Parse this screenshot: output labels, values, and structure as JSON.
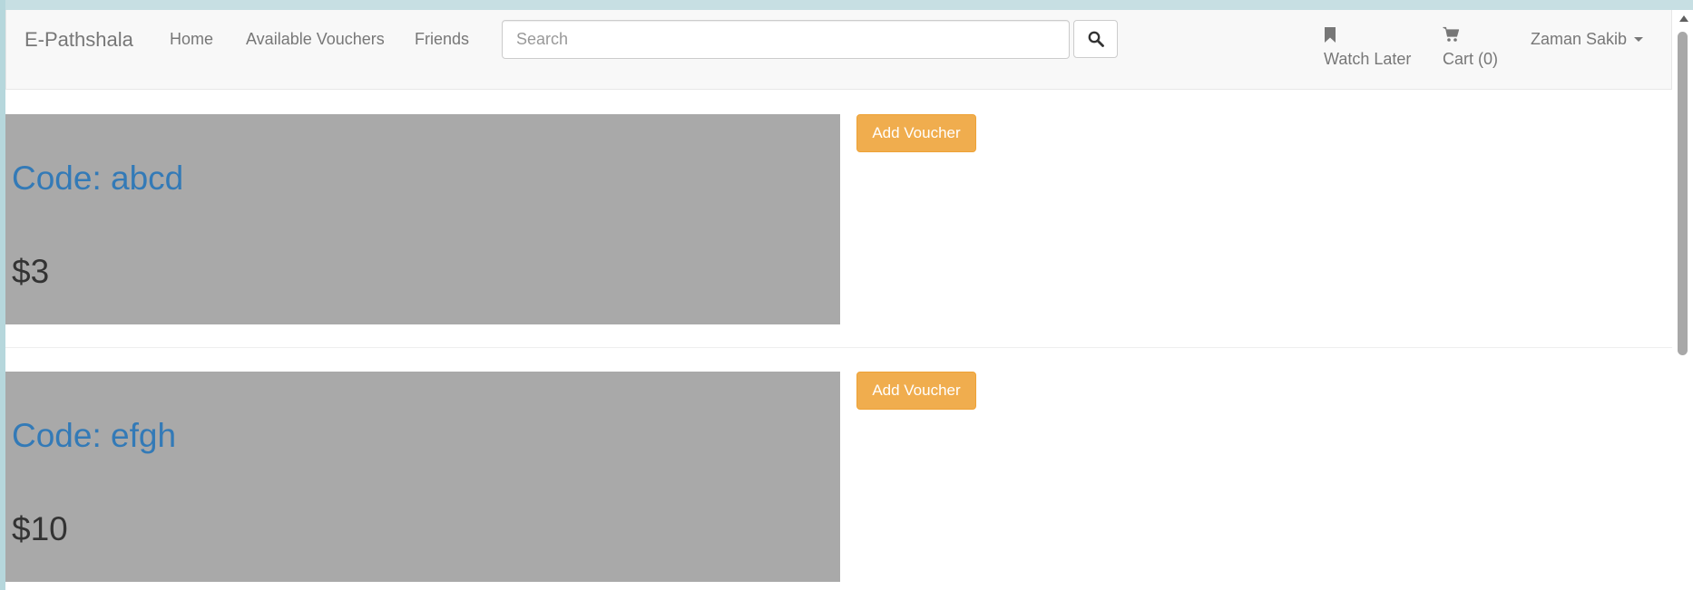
{
  "navbar": {
    "brand": "E-Pathshala",
    "links": [
      "Home",
      "Available Vouchers",
      "Friends"
    ],
    "search": {
      "placeholder": "Search",
      "value": ""
    },
    "search_button_icon": "search-icon",
    "watch_later": {
      "icon": "bookmark-icon",
      "label": "Watch Later"
    },
    "cart": {
      "icon": "cart-icon",
      "label": "Cart (0)"
    },
    "user": {
      "name": "Zaman Sakib"
    }
  },
  "vouchers": [
    {
      "code": "Code: abcd",
      "price": "$3",
      "button": "Add Voucher"
    },
    {
      "code": "Code: efgh",
      "price": "$10",
      "button": "Add Voucher"
    }
  ],
  "colors": {
    "link": "#337ab7",
    "button_warning": "#f0ad4e",
    "card_bg": "#a9a9a9",
    "navbar_bg": "#f8f8f8"
  }
}
